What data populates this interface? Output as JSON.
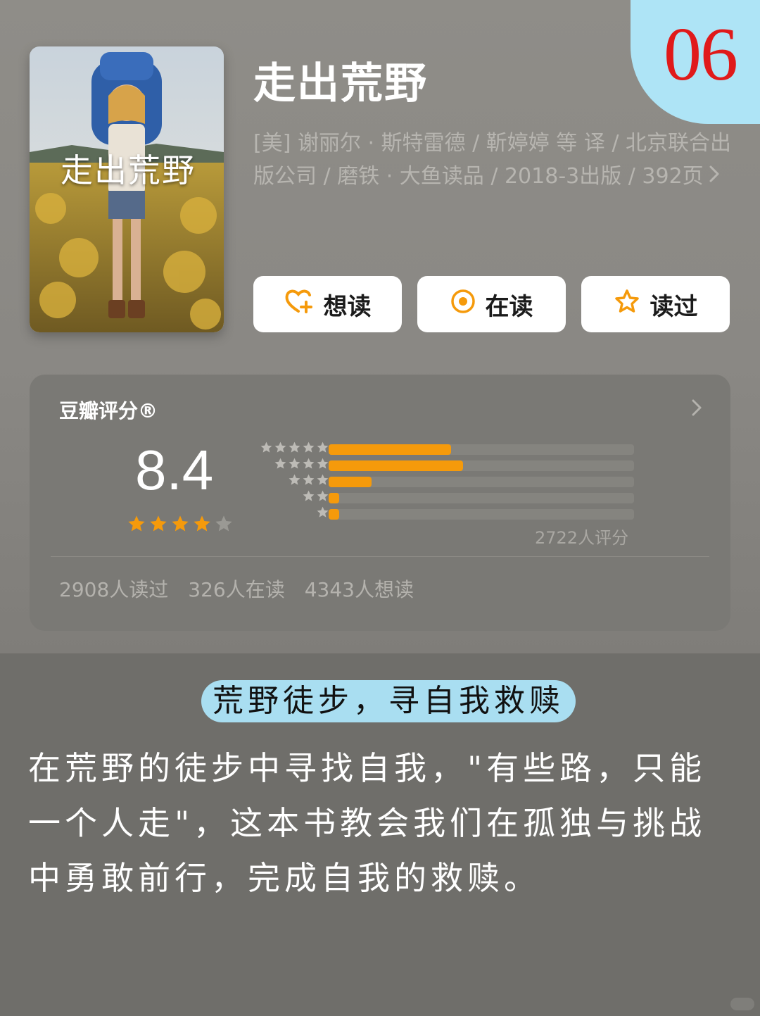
{
  "badge": {
    "number": "06"
  },
  "book": {
    "cover_title": "走出荒野",
    "title": "走出荒野",
    "meta_line": "[美] 谢丽尔 · 斯特雷德 / 靳婷婷 等 译 / 北京联合出版公司 / 磨铁 · 大鱼读品 / 2018-3出版 / 392页"
  },
  "actions": {
    "want_label": "想读",
    "reading_label": "在读",
    "read_label": "读过"
  },
  "rating": {
    "title": "豆瓣评分®",
    "score": "8.4",
    "stars_filled": 4,
    "stars_total": 5,
    "distribution_percent": [
      40,
      44,
      14,
      3,
      3
    ],
    "count_text": "2722人评分"
  },
  "stats": {
    "read": "2908人读过",
    "reading": "326人在读",
    "want": "4343人想读"
  },
  "caption": {
    "headline": "荒野徒步，寻自我救赎",
    "body": "在荒野的徒步中寻找自我，\"有些路，只能一个人走\"，这本书教会我们在孤独与挑战中勇敢前行，完成自我的救赎。"
  },
  "colors": {
    "accent_orange": "#f59a0b",
    "badge_blue": "#aee4f6",
    "badge_red": "#e01a1a"
  }
}
